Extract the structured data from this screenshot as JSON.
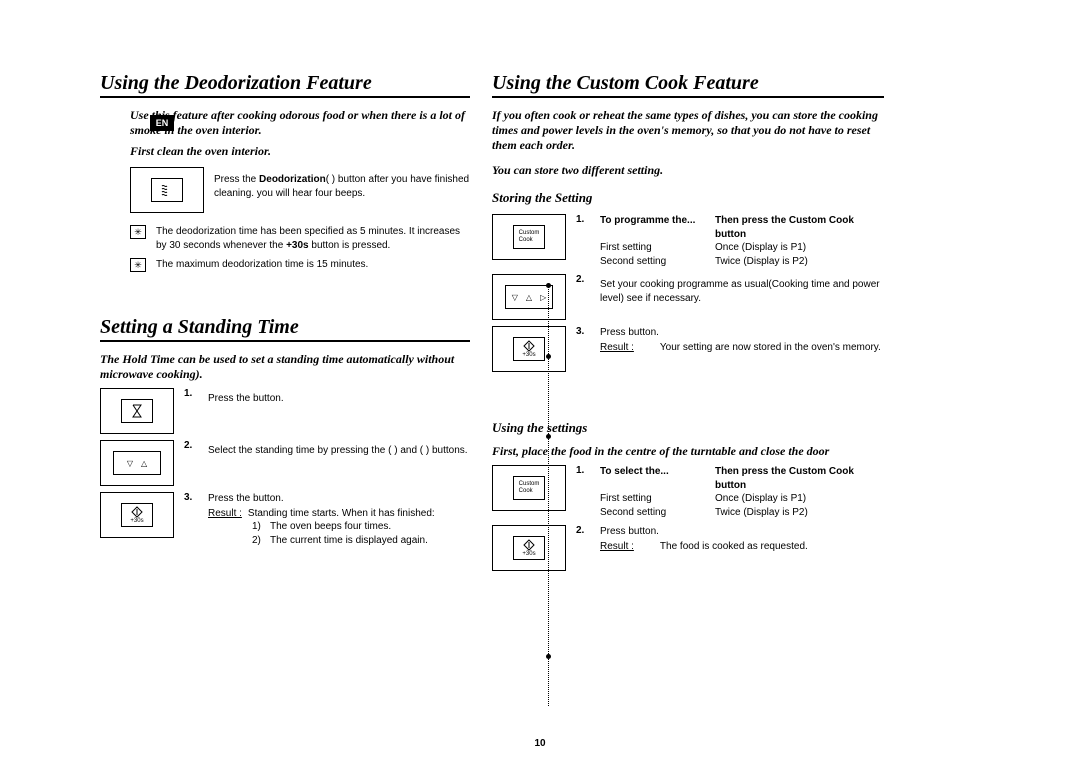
{
  "lang_tab": "EN",
  "page_number": "10",
  "left": {
    "deod": {
      "heading": "Using the Deodorization Feature",
      "intro": "Use this feature after cooking odorous food or when there is a lot of smoke in the oven interior.",
      "intro2": "First clean the oven interior.",
      "press_pre": "Press the ",
      "press_bold": "Deodorization",
      "press_post": "(     ) button after you have finished cleaning. you will hear four beeps.",
      "note1_pre": "The deodorization time has been specified as 5 minutes. It increases by 30 seconds whenever the ",
      "note1_bold": "+30s",
      "note1_post": " button is pressed.",
      "note2": "The maximum deodorization time is 15 minutes."
    },
    "stand": {
      "heading": "Setting a Standing Time",
      "intro": "The Hold Time can be used to set a standing time automatically without microwave cooking).",
      "s1": "Press the      button.",
      "s2": "Select the standing time by pressing the (       ) and (       ) buttons.",
      "s3a": "Press the        button.",
      "s3_result_label": "Result :",
      "s3_result": "Standing time starts. When it has finished:",
      "s3_1": "The oven beeps four times.",
      "s3_2": "The current time is displayed again.",
      "plus30": "+30s"
    }
  },
  "right": {
    "heading": "Using the Custom Cook Feature",
    "intro": "If you often cook or reheat the same types of dishes, you can store the cooking times and power levels in the oven's memory, so that you do not have to reset them each order.",
    "intro2": "You can store two different setting.",
    "store_h": "Storing the Setting",
    "custom_label": "Custom\nCook",
    "store_s1": {
      "h1": "To programme the...",
      "h2": "Then press the Custom Cook button",
      "r1a": "First setting",
      "r1b": "Once (Display is P1)",
      "r2a": "Second setting",
      "r2b": "Twice (Display is P2)"
    },
    "store_s2": "Set your cooking programme as usual(Cooking time and power level) see if necessary.",
    "store_s3a": "Press       button.",
    "store_s3_result_label": "Result :",
    "store_s3_result": "Your setting are now stored in the oven's memory.",
    "plus30": "+30s",
    "use_h": "Using the settings",
    "use_intro": "First, place the food in the centre of the turntable and close the door",
    "use_s1": {
      "h1": "To select the...",
      "h2": "Then press the Custom Cook button",
      "r1a": "First setting",
      "r1b": "Once (Display is P1)",
      "r2a": "Second setting",
      "r2b": "Twice (Display is P2)"
    },
    "use_s2a": "Press       button.",
    "use_s2_result_label": "Result :",
    "use_s2_result": "The food is cooked as requested."
  }
}
